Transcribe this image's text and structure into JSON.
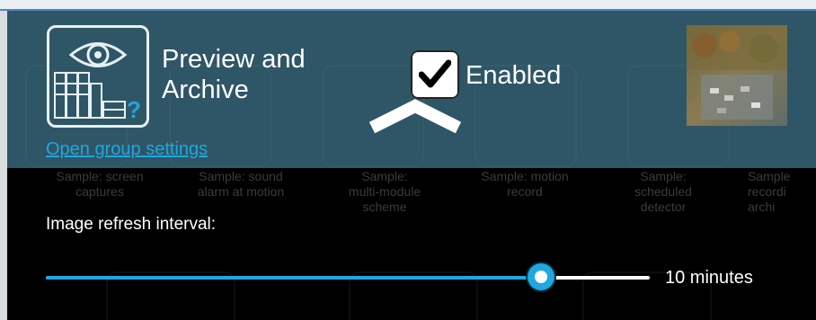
{
  "module": {
    "title_line1": "Preview and",
    "title_line2": "Archive",
    "icon": "eye-archive-icon"
  },
  "enabled": {
    "label": "Enabled",
    "checked": true
  },
  "links": {
    "open_group_settings": "Open group settings"
  },
  "samples": [
    {
      "line1": "Sample: screen",
      "line2": "captures",
      "line3": ""
    },
    {
      "line1": "Sample: sound",
      "line2": "alarm at motion",
      "line3": ""
    },
    {
      "line1": "Sample:",
      "line2": "multi-module",
      "line3": "scheme"
    },
    {
      "line1": "Sample: motion",
      "line2": "record",
      "line3": ""
    },
    {
      "line1": "Sample:",
      "line2": "scheduled",
      "line3": "detector"
    },
    {
      "line1": "Sample",
      "line2": "recordi",
      "line3": "archi"
    }
  ],
  "refresh": {
    "label": "Image refresh interval:",
    "value_text": "10 minutes",
    "fraction": 0.82
  },
  "colors": {
    "panel_top": "#2f5666",
    "accent": "#1ea7e0",
    "background": "#000000"
  }
}
